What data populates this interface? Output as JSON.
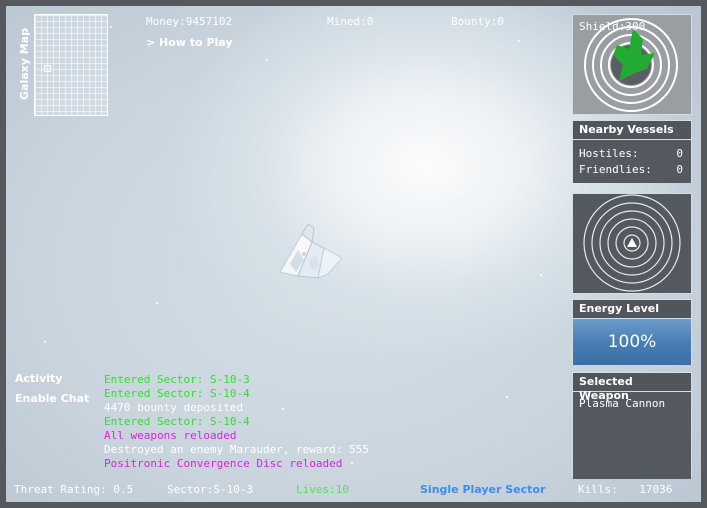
{
  "hud": {
    "money_label": "Money:",
    "money_value": "9457102",
    "mined_label": "Mined:",
    "mined_value": "0",
    "bounty_label": "Bounty:",
    "bounty_value": "0",
    "how_to_play": "> How to Play"
  },
  "galaxy_map": {
    "label": "Galaxy Map"
  },
  "left_menu": {
    "activity": "Activity",
    "enable_chat": "Enable Chat"
  },
  "log": [
    {
      "text": "Entered Sector: S-10-3",
      "color": "#33dd33"
    },
    {
      "text": "Entered Sector: S-10-4",
      "color": "#33dd33"
    },
    {
      "text": "4470 bounty deposited",
      "color": "#ffffff"
    },
    {
      "text": "Entered Sector: S-10-4",
      "color": "#33dd33"
    },
    {
      "text": "All weapons reloaded",
      "color": "#dd22dd"
    },
    {
      "text": "Destroyed an enemy Marauder, reward: 555",
      "color": "#ffffff"
    },
    {
      "text": "Positronic Convergence Disc reloaded",
      "color": "#dd22dd"
    }
  ],
  "status": {
    "threat_label": "Threat Rating:",
    "threat_value": "0.5",
    "sector_label": "Sector:",
    "sector_value": "S-10-3",
    "lives_label": "Lives:",
    "lives_value": "10",
    "mode": "Single Player Sector",
    "kills_label": "Kills:",
    "kills_value": "17036"
  },
  "panels": {
    "shield_label": "Shield:",
    "shield_value": "300",
    "nearby_title": "Nearby Vessels",
    "hostiles_label": "Hostiles:",
    "hostiles_value": "0",
    "friendlies_label": "Friendlies:",
    "friendlies_value": "0",
    "energy_title": "Energy Level",
    "energy_value": "100%",
    "weapon_title": "Selected Weapon",
    "weapon_value": "Plasma Cannon"
  },
  "colors": {
    "log_green": "#33dd33",
    "log_magenta": "#dd22dd",
    "lives_green": "#44ee44",
    "mode_blue": "#3a8ef0",
    "energy_blue": "#4a7eb4",
    "shield_green": "#22aa33"
  }
}
